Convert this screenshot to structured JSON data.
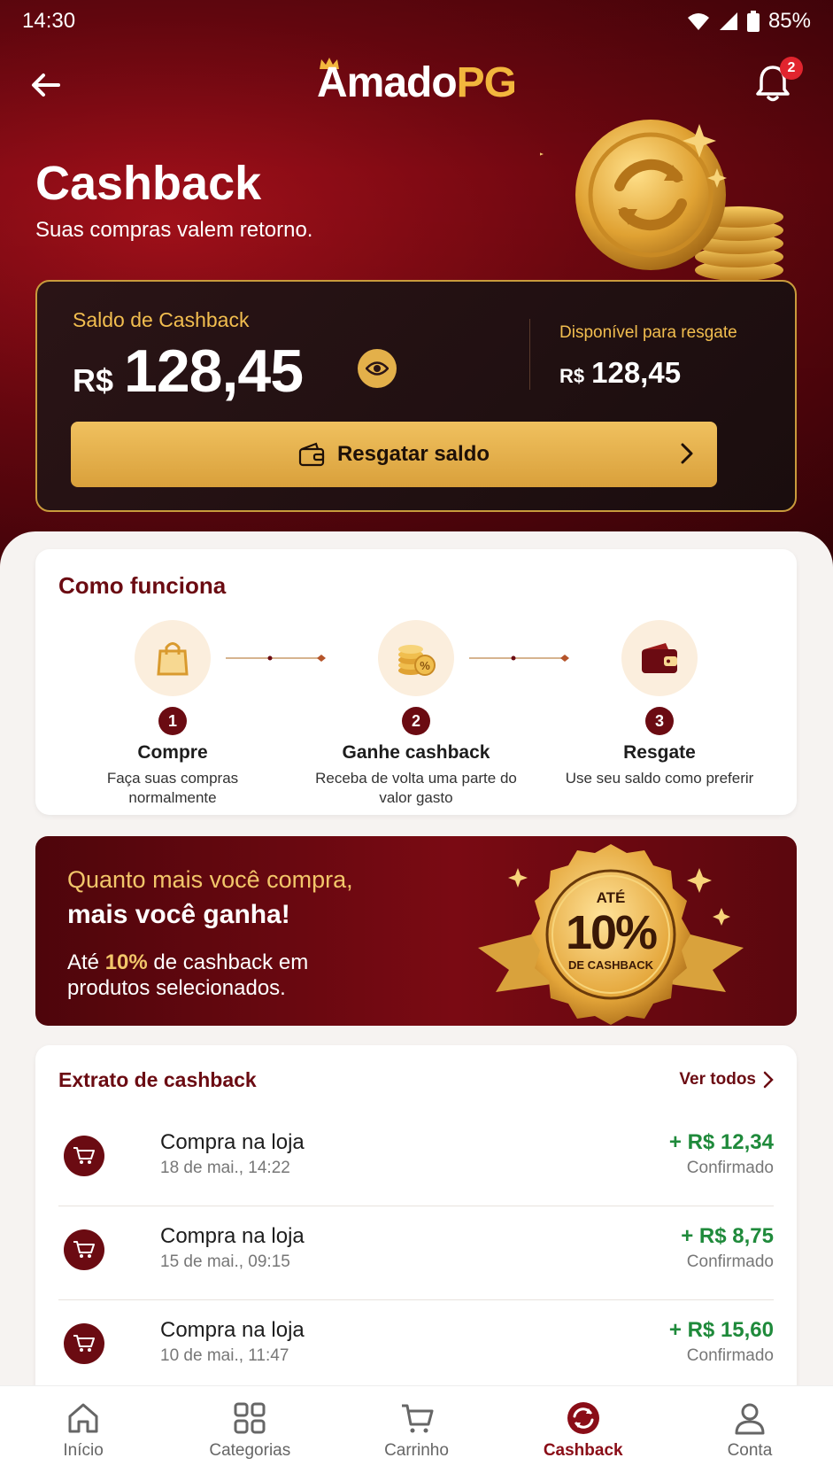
{
  "status_bar": {
    "time": "14:30",
    "battery": "85%"
  },
  "header": {
    "logo_part1": "Amado",
    "logo_part2": "PG",
    "notification_count": "2",
    "title": "Cashback",
    "subtitle": "Suas compras valem retorno."
  },
  "balance": {
    "label": "Saldo de Cashback",
    "currency": "R$",
    "amount": "128,45",
    "available_label": "Disponível para resgate",
    "available_currency": "R$",
    "available_amount": "128,45",
    "redeem_label": "Resgatar saldo"
  },
  "how_it_works": {
    "title": "Como funciona",
    "steps": [
      {
        "number": "1",
        "name": "Compre",
        "desc": "Faça suas compras normalmente",
        "icon": "shopping-bag-icon"
      },
      {
        "number": "2",
        "name": "Ganhe cashback",
        "desc": "Receba de volta uma parte do valor gasto",
        "icon": "coins-percent-icon"
      },
      {
        "number": "3",
        "name": "Resgate",
        "desc": "Use seu saldo como preferir",
        "icon": "wallet-icon"
      }
    ]
  },
  "promo": {
    "line1": "Quanto mais você compra,",
    "line2": "mais você ganha!",
    "line3_prefix": "Até ",
    "line3_highlight": "10%",
    "line3_suffix": " de cashback em produtos selecionados.",
    "seal_top": "ATÉ",
    "seal_value": "10%",
    "seal_bottom": "DE CASHBACK"
  },
  "statement": {
    "title": "Extrato de cashback",
    "see_all": "Ver todos",
    "rows": [
      {
        "name": "Compra na loja",
        "date": "18 de mai., 14:22",
        "amount": "+ R$ 12,34",
        "status": "Confirmado"
      },
      {
        "name": "Compra na loja",
        "date": "15 de mai., 09:15",
        "amount": "+ R$ 8,75",
        "status": "Confirmado"
      },
      {
        "name": "Compra na loja",
        "date": "10 de mai., 11:47",
        "amount": "+ R$ 15,60",
        "status": "Confirmado"
      }
    ]
  },
  "bottom_nav": [
    {
      "label": "Início",
      "icon": "home-icon"
    },
    {
      "label": "Categorias",
      "icon": "grid-icon"
    },
    {
      "label": "Carrinho",
      "icon": "cart-icon"
    },
    {
      "label": "Cashback",
      "icon": "cashback-icon",
      "active": true
    },
    {
      "label": "Conta",
      "icon": "user-icon"
    }
  ],
  "colors": {
    "brand_red": "#6b0b12",
    "gold": "#f2b63d",
    "positive": "#1f8a3b"
  }
}
